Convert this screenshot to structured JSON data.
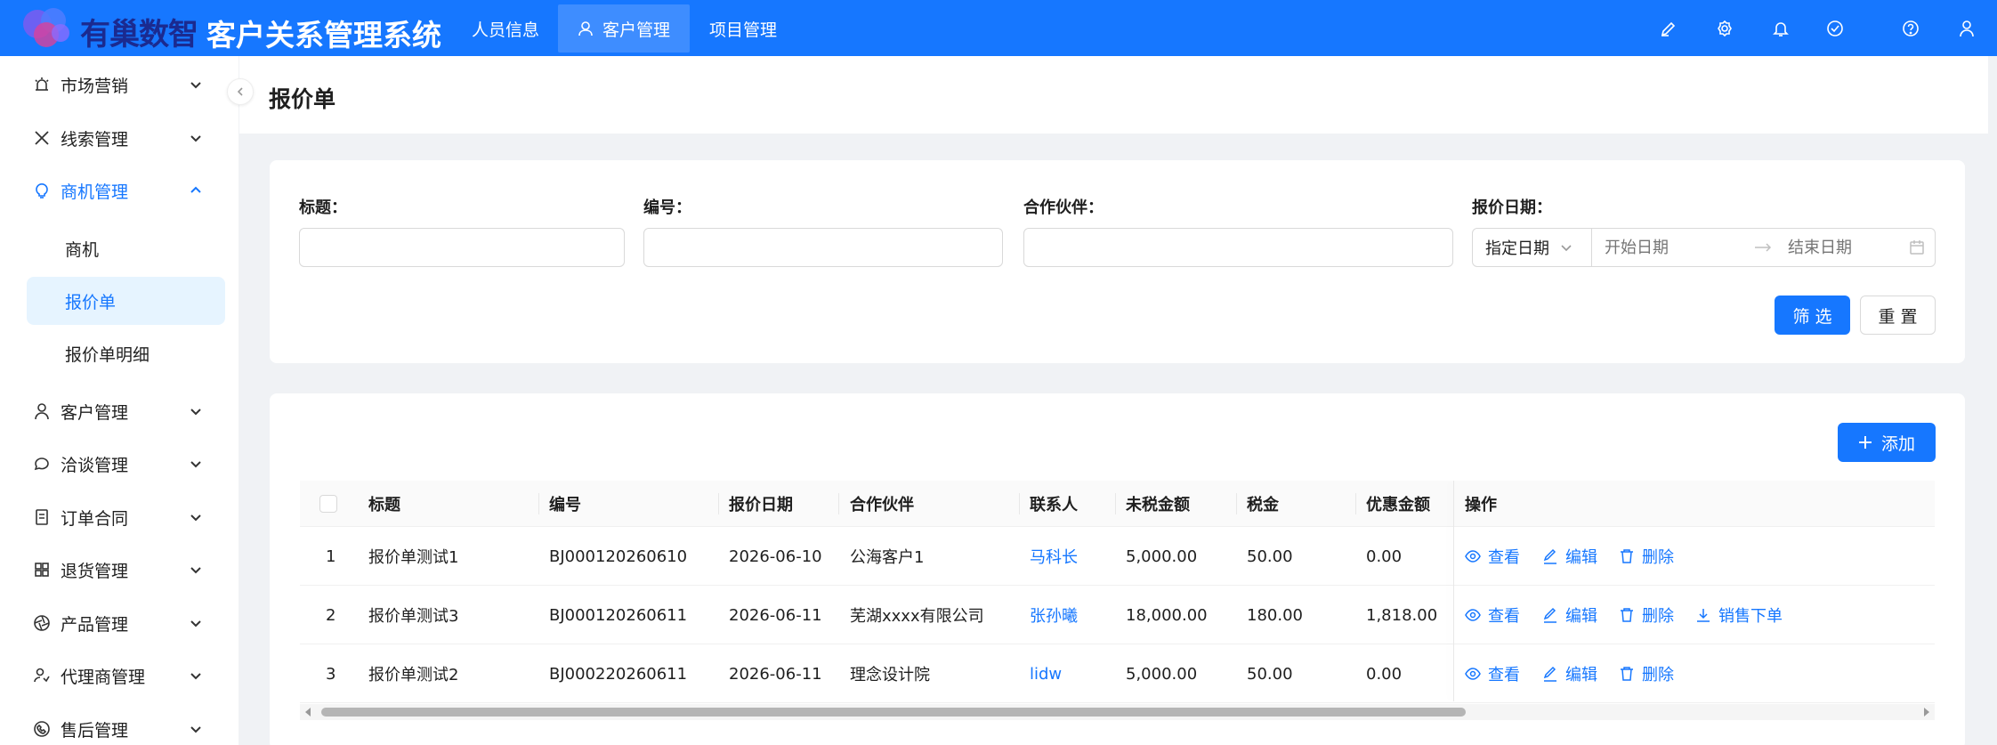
{
  "header": {
    "logo_text": "有巢数智",
    "system_title": "客户关系管理系统",
    "nav": [
      {
        "label": "人员信息"
      },
      {
        "label": "客户管理"
      },
      {
        "label": "项目管理"
      }
    ]
  },
  "sidebar": {
    "items": [
      {
        "label": "市场营销",
        "icon": "alarm-icon"
      },
      {
        "label": "线索管理",
        "icon": "x-icon"
      },
      {
        "label": "商机管理",
        "icon": "bulb-icon"
      },
      {
        "label": "客户管理",
        "icon": "user-icon"
      },
      {
        "label": "洽谈管理",
        "icon": "chat-icon"
      },
      {
        "label": "订单合同",
        "icon": "document-icon"
      },
      {
        "label": "退货管理",
        "icon": "grid-icon"
      },
      {
        "label": "产品管理",
        "icon": "aperture-icon"
      },
      {
        "label": "代理商管理",
        "icon": "agent-icon"
      },
      {
        "label": "售后管理",
        "icon": "phone-icon"
      }
    ],
    "sub_items": [
      {
        "label": "商机"
      },
      {
        "label": "报价单"
      },
      {
        "label": "报价单明细"
      }
    ]
  },
  "page": {
    "title": "报价单"
  },
  "filter": {
    "title_label": "标题：",
    "code_label": "编号：",
    "partner_label": "合作伙伴：",
    "date_label": "报价日期：",
    "date_mode": "指定日期",
    "start_placeholder": "开始日期",
    "end_placeholder": "结束日期",
    "filter_button": "筛 选",
    "reset_button": "重 置"
  },
  "toolbar": {
    "add_button": "添加"
  },
  "table": {
    "columns": [
      "标题",
      "编号",
      "报价日期",
      "合作伙伴",
      "联系人",
      "未税金额",
      "税金",
      "优惠金额",
      "操作"
    ],
    "rows": [
      {
        "no": "1",
        "title": "报价单测试1",
        "code": "BJ000120260610",
        "date": "2026-06-10",
        "partner": "公海客户1",
        "contact": "马科长",
        "pretax": "5,000.00",
        "tax": "50.00",
        "discount": "0.00"
      },
      {
        "no": "2",
        "title": "报价单测试3",
        "code": "BJ000120260611",
        "date": "2026-06-11",
        "partner": "芜湖xxxx有限公司",
        "contact": "张孙曦",
        "pretax": "18,000.00",
        "tax": "180.00",
        "discount": "1,818.00"
      },
      {
        "no": "3",
        "title": "报价单测试2",
        "code": "BJ000220260611",
        "date": "2026-06-11",
        "partner": "理念设计院",
        "contact": "lidw",
        "pretax": "5,000.00",
        "tax": "50.00",
        "discount": "0.00"
      }
    ],
    "actions": {
      "view": "查看",
      "edit": "编辑",
      "delete": "删除",
      "order": "销售下单"
    }
  },
  "colors": {
    "primary": "#1677ff",
    "header_bg": "#1677ff",
    "selected_bg": "#e6f4ff"
  }
}
